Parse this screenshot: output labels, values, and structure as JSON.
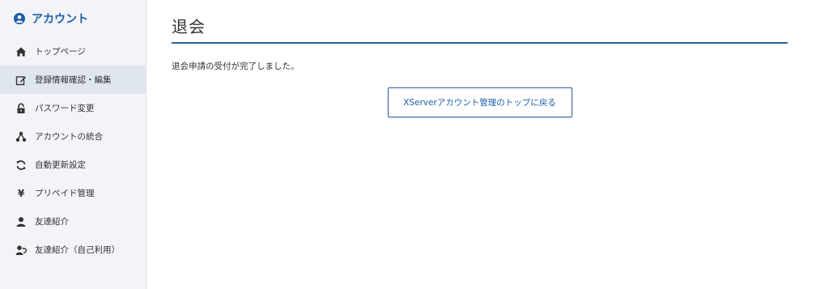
{
  "sidebar": {
    "header": {
      "icon": "account-circle-icon",
      "label": "アカウント"
    },
    "items": [
      {
        "icon": "home-icon",
        "label": "トップページ"
      },
      {
        "icon": "edit-icon",
        "label": "登録情報確認・編集",
        "active": true
      },
      {
        "icon": "lock-icon",
        "label": "パスワード変更"
      },
      {
        "icon": "merge-icon",
        "label": "アカウントの統合"
      },
      {
        "icon": "refresh-icon",
        "label": "自動更新設定"
      },
      {
        "icon": "yen-icon",
        "label": "プリペイド管理"
      },
      {
        "icon": "user-icon",
        "label": "友達紹介"
      },
      {
        "icon": "user-referral-icon",
        "label": "友達紹介（自己利用）"
      }
    ]
  },
  "main": {
    "title": "退会",
    "message": "退会申請の受付が完了しました。",
    "back_button_label": "XServerアカウント管理のトップに戻る"
  },
  "colors": {
    "accent": "#1f5ea8",
    "title_underline": "#2d5f9a",
    "sidebar_bg": "#f2f4f7",
    "active_bg": "#dfe6ee"
  }
}
